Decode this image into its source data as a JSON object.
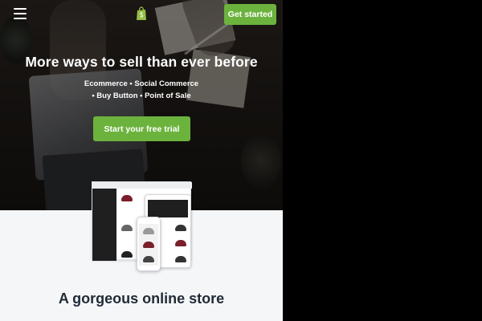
{
  "header": {
    "menu_icon": "hamburger-menu-icon",
    "logo_icon": "shopify-bag-icon",
    "cta_label": "Get started"
  },
  "hero": {
    "title": "More ways to sell than ever before",
    "channels_line1": "Ecommerce • Social Commerce",
    "channels_line2": "• Buy Button • Point of Sale",
    "cta_label": "Start your free trial"
  },
  "features": {
    "section_title": "A gorgeous online store"
  },
  "colors": {
    "accent": "#6cb33e",
    "heading": "#212b36",
    "section_bg": "#f4f6f8"
  }
}
